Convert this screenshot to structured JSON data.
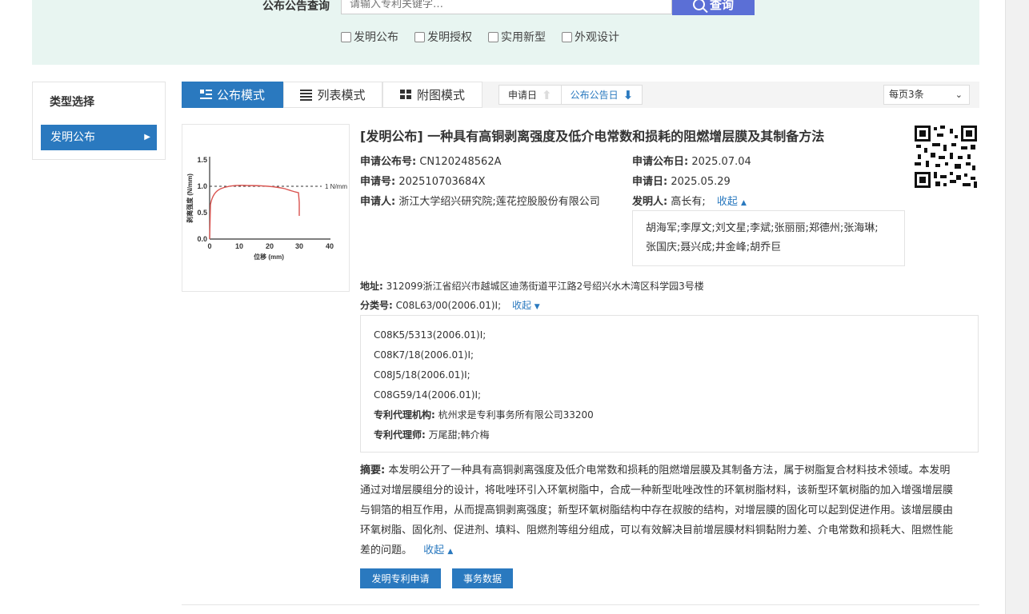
{
  "search": {
    "label": "公布公告查询",
    "placeholder": "请输入专利关键字…",
    "button": "查询",
    "checkboxes": [
      "发明公布",
      "发明授权",
      "实用新型",
      "外观设计"
    ]
  },
  "sidebar": {
    "title": "类型选择",
    "item": "发明公布"
  },
  "toolbar": {
    "modes": [
      "公布模式",
      "列表模式",
      "附图模式"
    ],
    "sort_apply": "申请日",
    "sort_publish": "公布公告日",
    "per_page": "每页3条"
  },
  "figure": {
    "x_label": "位移 (mm)",
    "y_label": "剥离强度 (N/mm)",
    "ref_label": "1 N/mm",
    "x_ticks": [
      "0",
      "10",
      "20",
      "30",
      "40"
    ],
    "y_ticks": [
      "0.0",
      "0.5",
      "1.0",
      "1.5"
    ]
  },
  "record": {
    "title": "[发明公布] 一种具有高铜剥离强度及低介电常数和损耗的阻燃增层膜及其制备方法",
    "pub_no_label": "申请公布号:",
    "pub_no": "CN120248562A",
    "pub_date_label": "申请公布日:",
    "pub_date": "2025.07.04",
    "app_no_label": "申请号:",
    "app_no": "202510703684X",
    "app_date_label": "申请日:",
    "app_date": "2025.05.29",
    "applicant_label": "申请人:",
    "applicant": "浙江大学绍兴研究院;莲花控股股份有限公司",
    "inventor_label": "发明人:",
    "inventor_first": "高长有;",
    "collapse": "收起",
    "inventors_more_1": "胡海军;李厚文;刘文星;李斌;张丽丽;郑德州;张海琳;",
    "inventors_more_2": "张国庆;聂兴成;井金峰;胡乔巨",
    "address_label": "地址:",
    "address": "312099浙江省绍兴市越城区迪荡街道平江路2号绍兴水木湾区科学园3号楼",
    "class_label": "分类号:",
    "class_first": "C08L63/00(2006.01)I;",
    "class_more": [
      "C08K5/5313(2006.01)I;",
      "C08K7/18(2006.01)I;",
      "C08J5/18(2006.01)I;",
      "C08G59/14(2006.01)I;"
    ],
    "agency_label": "专利代理机构:",
    "agency": "杭州求是专利事务所有限公司33200",
    "agent_label": "专利代理师:",
    "agent": "万尾甜;韩介梅",
    "abstract_label": "摘要:",
    "abstract_lines": [
      "本发明公开了一种具有高铜剥离强度及低介电常数和损耗的阻燃增层膜及其制备方法，属于树脂复合材料技术领域。本发明",
      "通过对增层膜组分的设计，将吡唑环引入环氧树脂中，合成一种新型吡唑改性的环氧树脂材料，该新型环氧树脂的加入增强增层膜",
      "与铜箔的相互作用，从而提高铜剥离强度；新型环氧树脂结构中存在叔胺的结构，对增层膜的固化可以起到促进作用。该增层膜由",
      "环氧树脂、固化剂、促进剂、填料、阻燃剂等组分组成，可以有效解决目前增层膜材料铜黏附力差、介电常数和损耗大、阻燃性能",
      "差的问题。"
    ],
    "btn_apply": "发明专利申请",
    "btn_events": "事务数据"
  },
  "colors": {
    "primary": "#2a79bf",
    "search_bg": "#e8f5f1",
    "search_button": "#5b6fd6",
    "curve": "#d9534f"
  }
}
